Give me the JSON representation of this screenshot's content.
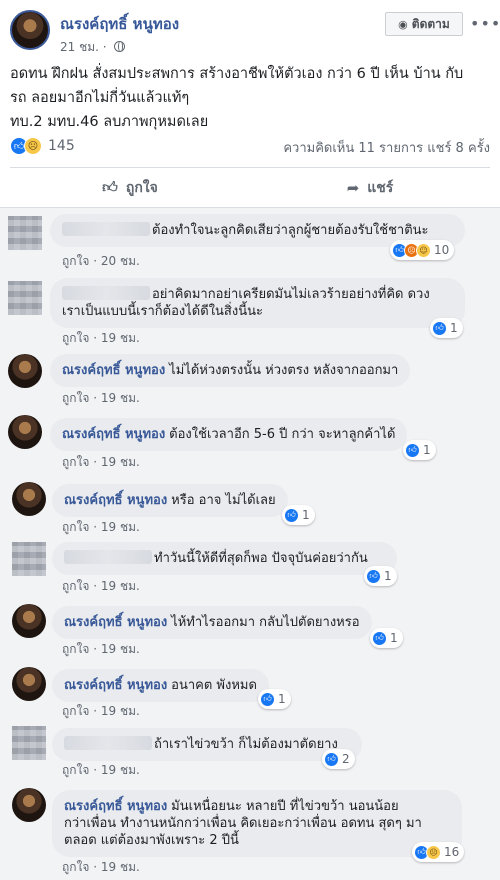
{
  "post": {
    "author": "ณรงค์ฤทธิ์ หนูทอง",
    "time": "21 ชม.",
    "follow_label": "ติดตาม",
    "text_lines": [
      "อดทน ฝึกฝน สั่งสมประสพการ สร้างอาชีพให้ตัวเอง กว่า 6 ปี เห็น บ้าน กับ",
      "รถ ลอยมาอีกไม่กี่วันแล้วแท้ๆ",
      "ทบ.2 มทบ.46 ลบภาพกุหมดเลย"
    ],
    "reaction_count": "145",
    "comment_share_text": "ความคิดเห็น 11 รายการ  แชร์ 8 ครั้ง",
    "like_action": "ถูกใจ",
    "share_action": "แชร์"
  },
  "comments": [
    {
      "author": "",
      "text": "ต้องทำใจนะลูกคิดเสียว่าลูกผู้ชายต้องรับใช้ชาตินะ",
      "like_label": "ถูกใจ",
      "time": "20 ชม.",
      "reaction_count": "10"
    },
    {
      "author": "",
      "text_lines": [
        "อย่าคิดมากอย่าเครียดมันไม่เลวร้ายอย่างที่คิด ดวง",
        "เราเป็นแบบนี้เราก็ต้องได้ดีในสิ่งนี้นะ"
      ],
      "like_label": "ถูกใจ",
      "time": "19 ชม.",
      "reaction_count": "1"
    },
    {
      "author": "ณรงค์ฤทธิ์ หนูทอง",
      "text": "ไม่ได้ห่วงตรงนั้น ห่วงตรง หลังจากออกมา",
      "like_label": "ถูกใจ",
      "time": "19 ชม."
    },
    {
      "author": "ณรงค์ฤทธิ์ หนูทอง",
      "text": "ต้องใช้เวลาอีก 5-6 ปี กว่า จะหาลูกค้าได้",
      "like_label": "ถูกใจ",
      "time": "19 ชม.",
      "reaction_count": "1"
    },
    {
      "author": "ณรงค์ฤทธิ์ หนูทอง",
      "text": "หรือ อาจ ไม่ได้เลย",
      "like_label": "ถูกใจ",
      "time": "19 ชม.",
      "reaction_count": "1"
    },
    {
      "author": "",
      "text": "ทำวันนี้ให้ดีที่สุดก็พอ ปัจจุบันค่อยว่ากัน",
      "like_label": "ถูกใจ",
      "time": "19 ชม.",
      "reaction_count": "1"
    },
    {
      "author": "ณรงค์ฤทธิ์ หนูทอง",
      "text": "ไห้ทำไรออกมา กลับไปตัดยางหรอ",
      "like_label": "ถูกใจ",
      "time": "19 ชม.",
      "reaction_count": "1"
    },
    {
      "author": "ณรงค์ฤทธิ์ หนูทอง",
      "text": "อนาคต พังหมด",
      "like_label": "ถูกใจ",
      "time": "19 ชม.",
      "reaction_count": "1"
    },
    {
      "author": "",
      "text": "ถ้าเราไข่วขว้า ก็ไม่ต้องมาตัดยาง",
      "like_label": "ถูกใจ",
      "time": "19 ชม.",
      "reaction_count": "2"
    },
    {
      "author": "ณรงค์ฤทธิ์ หนูทอง",
      "text_lines": [
        "มันเหนื่อยนะ หลายปี ที่ไข่วขว้า นอนน้อย",
        "กว่าเพื่อน ทำงานหนักกว่าเพื่อน คิดเยอะกว่าเพื่อน อดทน สุดๆ มา",
        "ตลอด แต่ต้องมาพังเพราะ 2 ปีนี้"
      ],
      "like_label": "ถูกใจ",
      "time": "19 ชม.",
      "reaction_count": "16"
    }
  ],
  "colors": {
    "link": "#385898",
    "like_blue": "#1877f2",
    "meta": "#606770"
  }
}
